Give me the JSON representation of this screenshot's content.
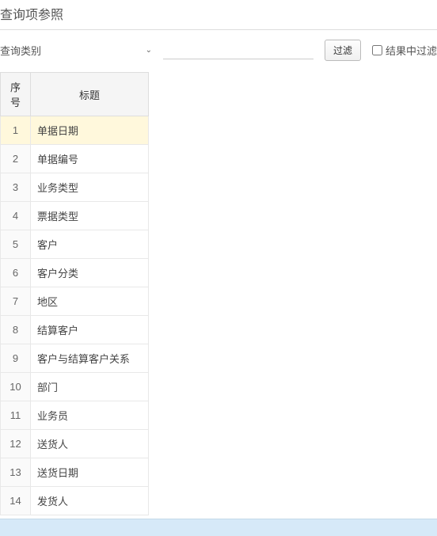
{
  "header": {
    "title": "查询项参照"
  },
  "filter": {
    "dropdown_label": "查询类别",
    "button_label": "过滤",
    "checkbox_label": "结果中过滤",
    "input_value": ""
  },
  "table": {
    "headers": {
      "seq": "序号",
      "title": "标题"
    },
    "rows": [
      {
        "seq": "1",
        "title": "单据日期",
        "selected": true
      },
      {
        "seq": "2",
        "title": "单据编号",
        "selected": false
      },
      {
        "seq": "3",
        "title": "业务类型",
        "selected": false
      },
      {
        "seq": "4",
        "title": "票据类型",
        "selected": false
      },
      {
        "seq": "5",
        "title": "客户",
        "selected": false
      },
      {
        "seq": "6",
        "title": "客户分类",
        "selected": false
      },
      {
        "seq": "7",
        "title": "地区",
        "selected": false
      },
      {
        "seq": "8",
        "title": "结算客户",
        "selected": false
      },
      {
        "seq": "9",
        "title": "客户与结算客户关系",
        "selected": false
      },
      {
        "seq": "10",
        "title": "部门",
        "selected": false
      },
      {
        "seq": "11",
        "title": "业务员",
        "selected": false
      },
      {
        "seq": "12",
        "title": "送货人",
        "selected": false
      },
      {
        "seq": "13",
        "title": "送货日期",
        "selected": false
      },
      {
        "seq": "14",
        "title": "发货人",
        "selected": false
      }
    ]
  }
}
